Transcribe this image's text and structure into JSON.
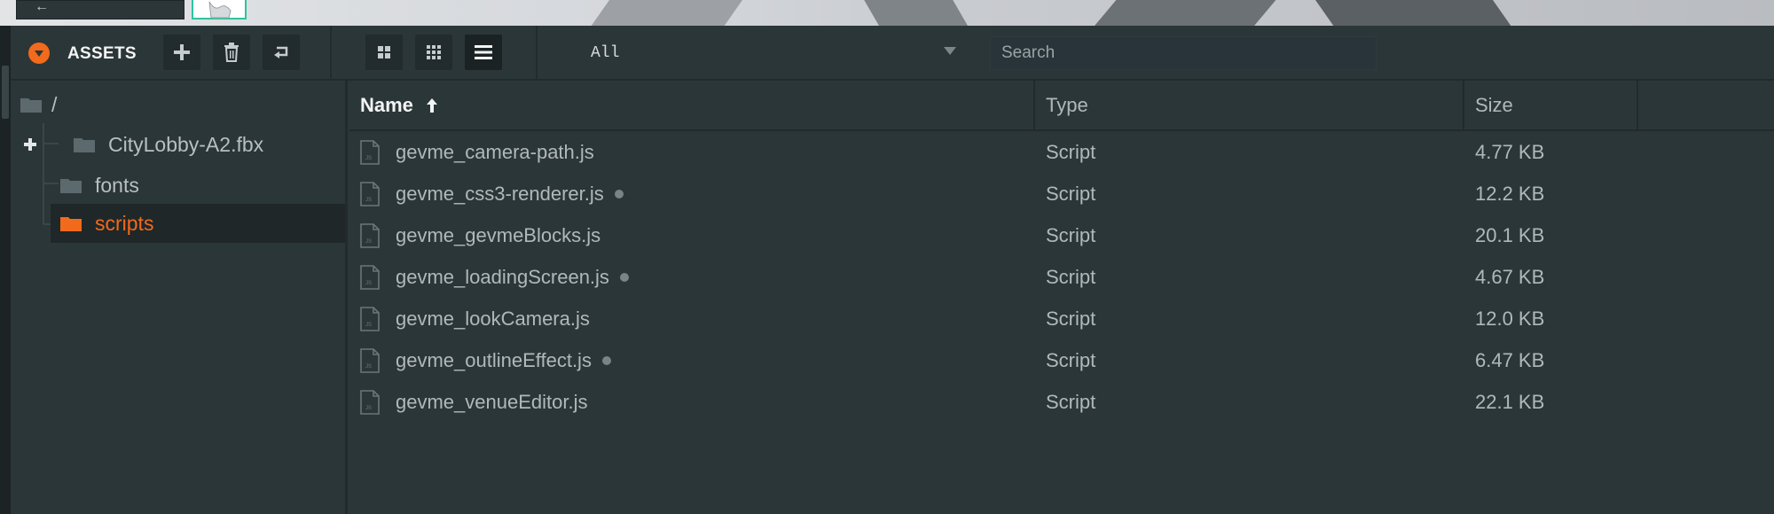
{
  "panel": {
    "title": "ASSETS",
    "buttons": [
      "add-icon",
      "delete-icon",
      "import-icon"
    ],
    "views": [
      "grid-large-icon",
      "grid-small-icon",
      "list-icon"
    ],
    "active_view": "list-icon"
  },
  "filter": {
    "selected": "All"
  },
  "search": {
    "placeholder": "Search",
    "value": ""
  },
  "tree": {
    "root": "/",
    "items": [
      {
        "label": "CityLobby-A2.fbx",
        "expandable": true,
        "selected": false
      },
      {
        "label": "fonts",
        "expandable": false,
        "selected": false
      },
      {
        "label": "scripts",
        "expandable": false,
        "selected": true
      }
    ]
  },
  "table": {
    "columns": [
      "Name",
      "Type",
      "Size"
    ],
    "sort": {
      "column": "Name",
      "direction": "ascending"
    },
    "rows": [
      {
        "name": "gevme_camera-path.js",
        "type": "Script",
        "size": "4.77 KB",
        "modified": false
      },
      {
        "name": "gevme_css3-renderer.js",
        "type": "Script",
        "size": "12.2 KB",
        "modified": true
      },
      {
        "name": "gevme_gevmeBlocks.js",
        "type": "Script",
        "size": "20.1 KB",
        "modified": false
      },
      {
        "name": "gevme_loadingScreen.js",
        "type": "Script",
        "size": "4.67 KB",
        "modified": true
      },
      {
        "name": "gevme_lookCamera.js",
        "type": "Script",
        "size": "12.0 KB",
        "modified": false
      },
      {
        "name": "gevme_outlineEffect.js",
        "type": "Script",
        "size": "6.47 KB",
        "modified": true
      },
      {
        "name": "gevme_venueEditor.js",
        "type": "Script",
        "size": "22.1 KB",
        "modified": false
      }
    ]
  },
  "colors": {
    "accent": "#f26a1b",
    "background": "#2b3638",
    "selected_row": "#1f2729",
    "thumbnail_border": "#2ec4a0"
  }
}
